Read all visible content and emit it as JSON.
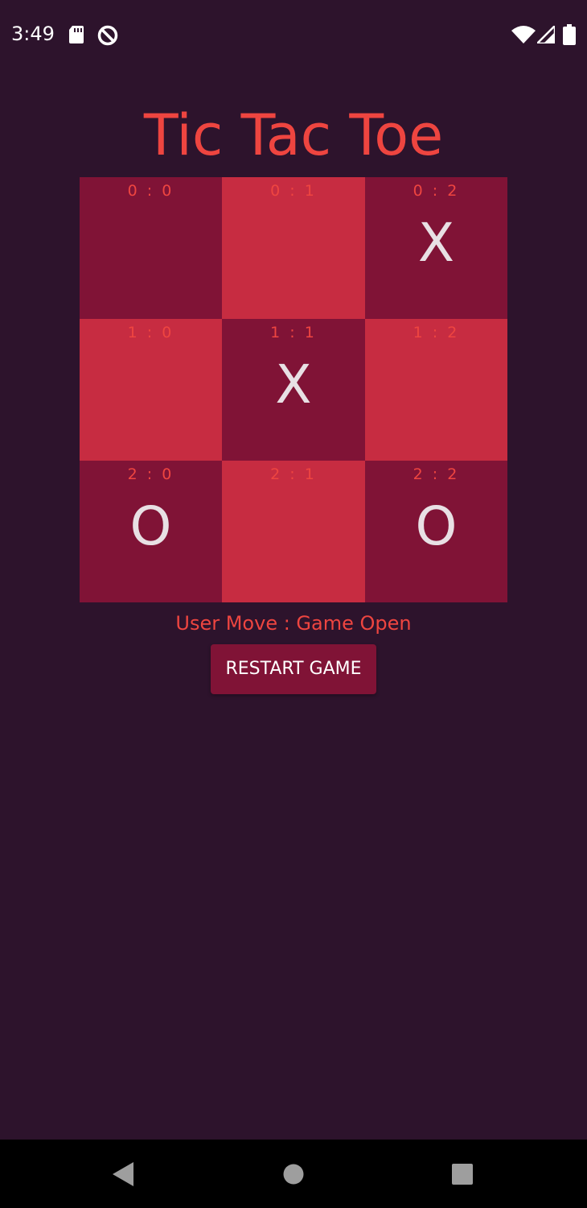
{
  "status_bar": {
    "time": "3:49",
    "icons": [
      "sd-card-icon",
      "data-saver-icon",
      "wifi-icon",
      "signal-icon",
      "battery-icon"
    ]
  },
  "title": "Tic Tac Toe",
  "board": {
    "cells": [
      {
        "coord": "0 : 0",
        "mark": "",
        "shade": "dark"
      },
      {
        "coord": "0 : 1",
        "mark": "",
        "shade": "light"
      },
      {
        "coord": "0 : 2",
        "mark": "X",
        "shade": "dark"
      },
      {
        "coord": "1 : 0",
        "mark": "",
        "shade": "light"
      },
      {
        "coord": "1 : 1",
        "mark": "X",
        "shade": "dark"
      },
      {
        "coord": "1 : 2",
        "mark": "",
        "shade": "light"
      },
      {
        "coord": "2 : 0",
        "mark": "O",
        "shade": "dark"
      },
      {
        "coord": "2 : 1",
        "mark": "",
        "shade": "light"
      },
      {
        "coord": "2 : 2",
        "mark": "O",
        "shade": "dark"
      }
    ]
  },
  "status_text": "User Move : Game Open",
  "restart_label": "RESTART GAME",
  "colors": {
    "background": "#2d132c",
    "accent_text": "#ee4540",
    "cell_dark": "#801336",
    "cell_light": "#c72c41",
    "mark": "#e8e0e4"
  },
  "nav_bar": {
    "icons": [
      "back-icon",
      "home-icon",
      "recents-icon"
    ]
  }
}
